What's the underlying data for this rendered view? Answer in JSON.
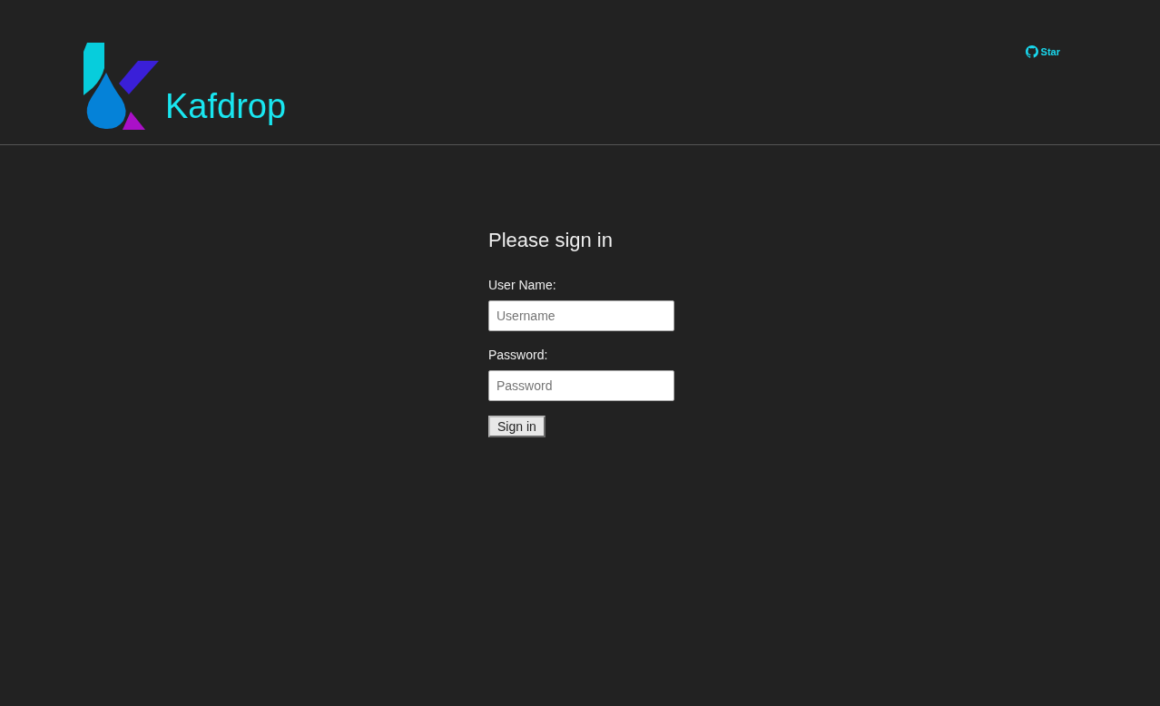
{
  "header": {
    "brand": "Kafdrop",
    "star_label": "Star"
  },
  "form": {
    "title": "Please sign in",
    "fields": [
      {
        "label": "User Name:",
        "placeholder": "Username"
      },
      {
        "label": "Password:",
        "placeholder": "Password"
      }
    ],
    "submit": "Sign in"
  }
}
